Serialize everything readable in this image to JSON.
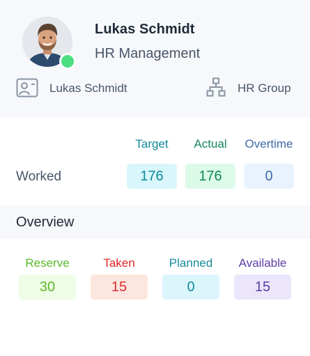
{
  "profile": {
    "name": "Lukas Schmidt",
    "department": "HR Management",
    "status_color": "#4ade80",
    "meta": [
      {
        "icon": "id-card-icon",
        "text": "Lukas Schmidt"
      },
      {
        "icon": "org-chart-icon",
        "text": "HR Group"
      }
    ]
  },
  "worked": {
    "row_label": "Worked",
    "columns": [
      {
        "label": "Target",
        "value": "176",
        "label_color": "#0e8a9a",
        "value_color": "#0e8a9a",
        "bg": "#d8f6fb"
      },
      {
        "label": "Actual",
        "value": "176",
        "label_color": "#13875a",
        "value_color": "#13875a",
        "bg": "#dcfae8"
      },
      {
        "label": "Overtime",
        "value": "0",
        "label_color": "#3e6aa8",
        "value_color": "#3e6aa8",
        "bg": "#e9f3fe"
      }
    ]
  },
  "overview": {
    "title": "Overview",
    "items": [
      {
        "label": "Reserve",
        "value": "30",
        "label_color": "#5bb82a",
        "value_color": "#5bb82a",
        "bg": "#eefde6"
      },
      {
        "label": "Taken",
        "value": "15",
        "label_color": "#e02424",
        "value_color": "#d83030",
        "bg": "#fde6e0"
      },
      {
        "label": "Planned",
        "value": "0",
        "label_color": "#138a99",
        "value_color": "#138a99",
        "bg": "#daf6fb"
      },
      {
        "label": "Available",
        "value": "15",
        "label_color": "#5b3ea6",
        "value_color": "#5b3ea6",
        "bg": "#ebe6fb"
      }
    ]
  }
}
